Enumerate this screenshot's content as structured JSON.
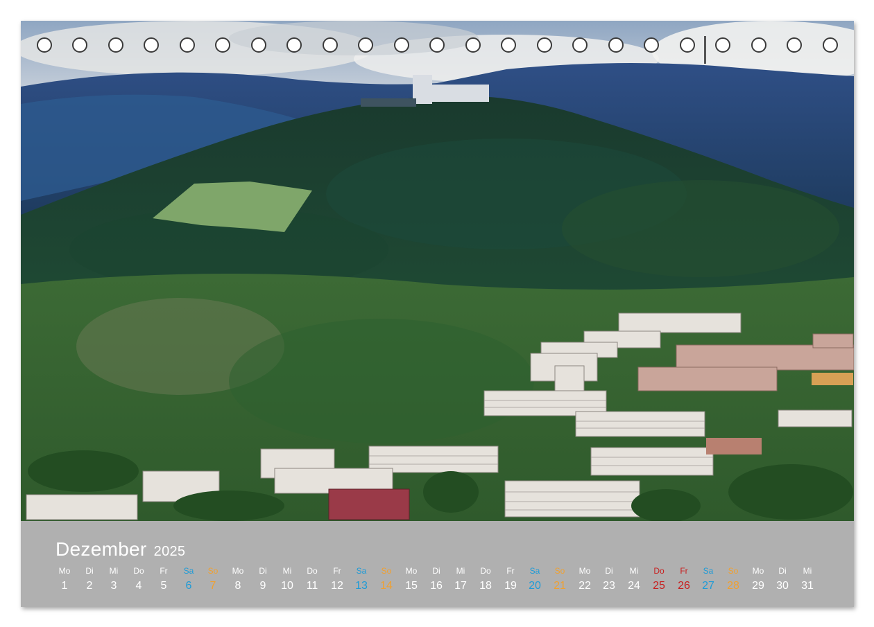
{
  "calendar": {
    "month": "Dezember",
    "year": "2025",
    "days": [
      {
        "name": "Mo",
        "num": "1",
        "type": "weekday"
      },
      {
        "name": "Di",
        "num": "2",
        "type": "weekday"
      },
      {
        "name": "Mi",
        "num": "3",
        "type": "weekday"
      },
      {
        "name": "Do",
        "num": "4",
        "type": "weekday"
      },
      {
        "name": "Fr",
        "num": "5",
        "type": "weekday"
      },
      {
        "name": "Sa",
        "num": "6",
        "type": "sat"
      },
      {
        "name": "So",
        "num": "7",
        "type": "sun"
      },
      {
        "name": "Mo",
        "num": "8",
        "type": "weekday"
      },
      {
        "name": "Di",
        "num": "9",
        "type": "weekday"
      },
      {
        "name": "Mi",
        "num": "10",
        "type": "weekday"
      },
      {
        "name": "Do",
        "num": "11",
        "type": "weekday"
      },
      {
        "name": "Fr",
        "num": "12",
        "type": "weekday"
      },
      {
        "name": "Sa",
        "num": "13",
        "type": "sat"
      },
      {
        "name": "So",
        "num": "14",
        "type": "sun"
      },
      {
        "name": "Mo",
        "num": "15",
        "type": "weekday"
      },
      {
        "name": "Di",
        "num": "16",
        "type": "weekday"
      },
      {
        "name": "Mi",
        "num": "17",
        "type": "weekday"
      },
      {
        "name": "Do",
        "num": "18",
        "type": "weekday"
      },
      {
        "name": "Fr",
        "num": "19",
        "type": "weekday"
      },
      {
        "name": "Sa",
        "num": "20",
        "type": "sat"
      },
      {
        "name": "So",
        "num": "21",
        "type": "sun"
      },
      {
        "name": "Mo",
        "num": "22",
        "type": "weekday"
      },
      {
        "name": "Di",
        "num": "23",
        "type": "weekday"
      },
      {
        "name": "Mi",
        "num": "24",
        "type": "weekday"
      },
      {
        "name": "Do",
        "num": "25",
        "type": "holiday"
      },
      {
        "name": "Fr",
        "num": "26",
        "type": "holiday"
      },
      {
        "name": "Sa",
        "num": "27",
        "type": "sat"
      },
      {
        "name": "So",
        "num": "28",
        "type": "sun"
      },
      {
        "name": "Mo",
        "num": "29",
        "type": "weekday"
      },
      {
        "name": "Di",
        "num": "30",
        "type": "weekday"
      },
      {
        "name": "Mi",
        "num": "31",
        "type": "weekday"
      }
    ]
  },
  "colors": {
    "strip": "#b0b0b0",
    "weekday": "#ffffff",
    "saturday": "#1e9bd7",
    "sunday": "#f0a030",
    "holiday": "#c81e1e"
  }
}
